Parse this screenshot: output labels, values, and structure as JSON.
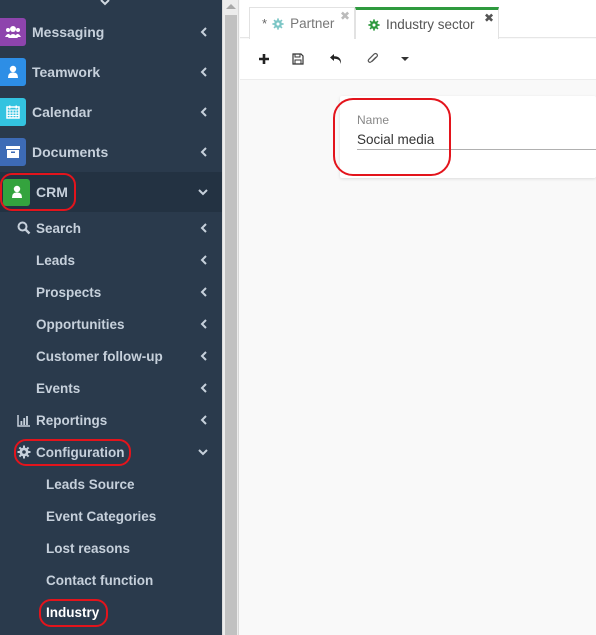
{
  "sidebar": {
    "apps": [
      {
        "label": "Messaging",
        "icon": "users-icon",
        "color": "#8e44ad"
      },
      {
        "label": "Teamwork",
        "icon": "user-icon",
        "color": "#2d8ee6"
      },
      {
        "label": "Calendar",
        "icon": "calendar-icon",
        "color": "#33c3e0"
      },
      {
        "label": "Documents",
        "icon": "archive-icon",
        "color": "#3d6bb6"
      },
      {
        "label": "CRM",
        "icon": "user-icon",
        "color": "#34a33e"
      }
    ],
    "crm_items": [
      {
        "label": "Search",
        "icon": "search-icon"
      },
      {
        "label": "Leads"
      },
      {
        "label": "Prospects"
      },
      {
        "label": "Opportunities"
      },
      {
        "label": "Customer follow-up"
      },
      {
        "label": "Events"
      },
      {
        "label": "Reportings",
        "icon": "bar-chart-icon"
      },
      {
        "label": "Configuration",
        "icon": "gear-icon"
      }
    ],
    "config_items": [
      {
        "label": "Leads Source"
      },
      {
        "label": "Event Categories"
      },
      {
        "label": "Lost reasons"
      },
      {
        "label": "Contact function"
      },
      {
        "label": "Industry",
        "active": true
      }
    ]
  },
  "tabs": [
    {
      "label": "Partner",
      "modified_marker": "*",
      "active": false,
      "icon_color": "#7cc6c6"
    },
    {
      "label": "Industry sector",
      "active": true,
      "icon_color": "#2e9a3e",
      "accent": "#2e9a3e"
    }
  ],
  "toolbar": {
    "buttons": [
      "add",
      "save",
      "undo",
      "attachment",
      "more-dropdown"
    ]
  },
  "form": {
    "name_label": "Name",
    "name_value": "Social media"
  },
  "annotation_color": "#e3141c"
}
